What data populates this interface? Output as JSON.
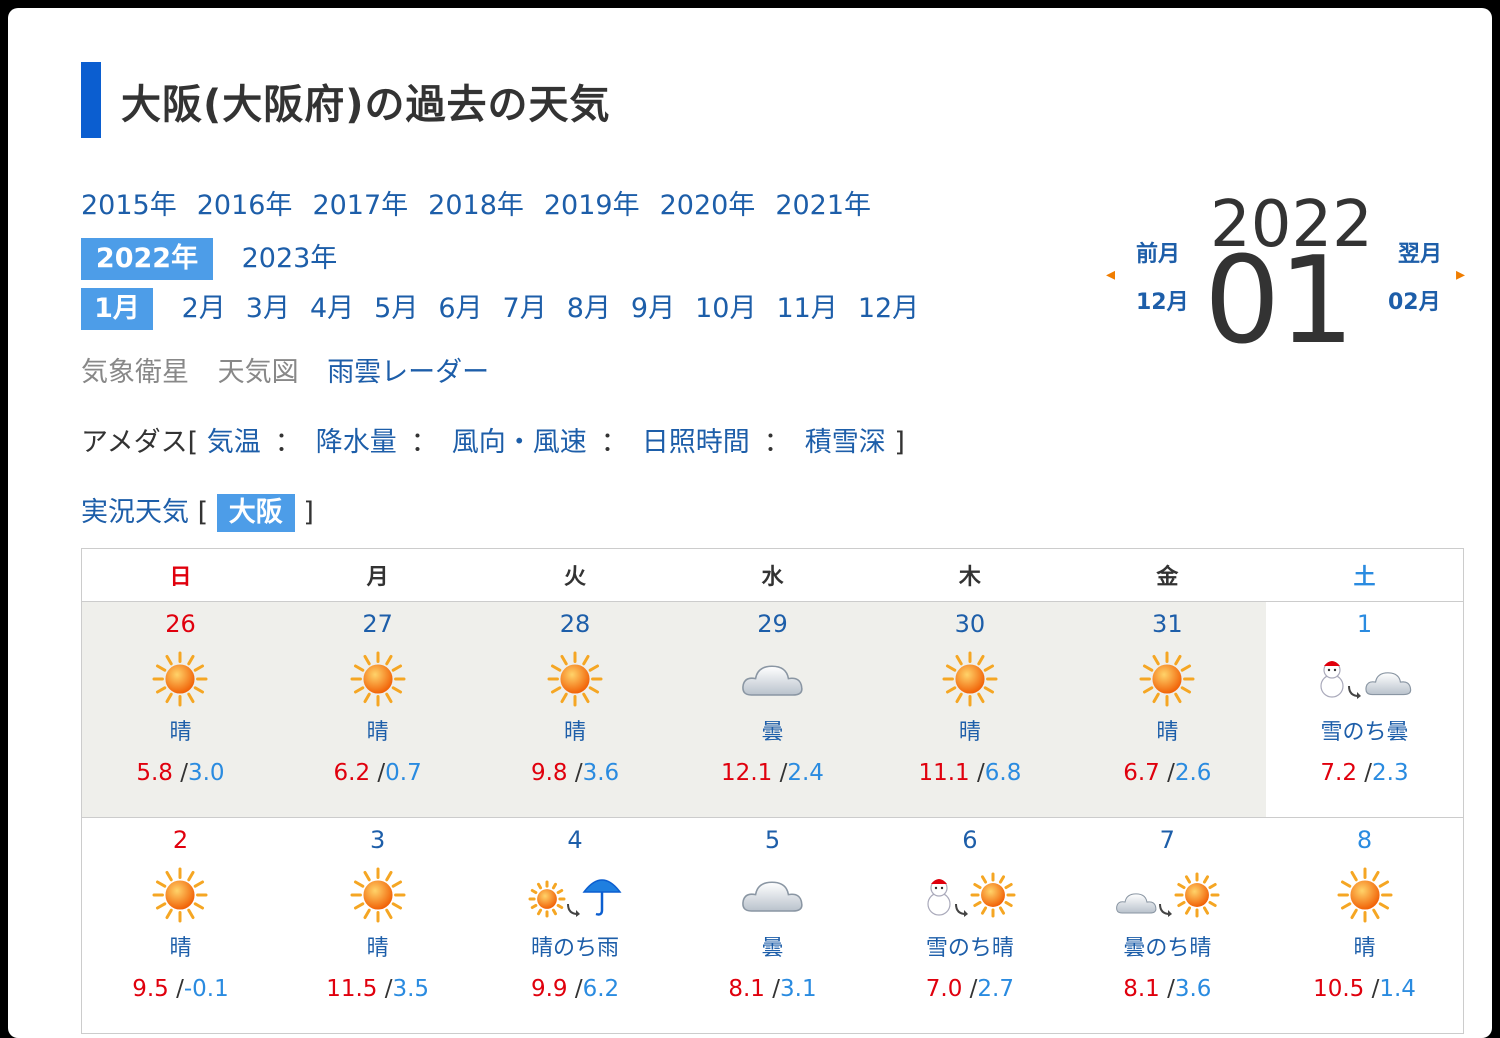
{
  "title": "大阪(大阪府)の過去の天気",
  "years": [
    "2015年",
    "2016年",
    "2017年",
    "2018年",
    "2019年",
    "2020年",
    "2021年"
  ],
  "years_row2_selected": "2022年",
  "years_row2_other": "2023年",
  "months_selected": "1月",
  "months": [
    "2月",
    "3月",
    "4月",
    "5月",
    "6月",
    "7月",
    "8月",
    "9月",
    "10月",
    "11月",
    "12月"
  ],
  "maps": {
    "satellite": "気象衛星",
    "weathermap": "天気図",
    "radar": "雨雲レーダー"
  },
  "amedas": {
    "prefix": "アメダス[",
    "items": [
      "気温",
      "降水量",
      "風向・風速",
      "日照時間",
      "積雪深"
    ],
    "sep": "：",
    "suffix": "]"
  },
  "jikkyo": {
    "label": "実況天気",
    "open": "[",
    "selected": "大阪",
    "close": "]"
  },
  "nav": {
    "year": "2022",
    "month": "01",
    "prev_label": "前月",
    "prev_month": "12月",
    "next_label": "翌月",
    "next_month": "02月",
    "arrow_color": "#f07d00"
  },
  "weekdays": [
    "日",
    "月",
    "火",
    "水",
    "木",
    "金",
    "土"
  ],
  "weeks": [
    [
      {
        "day": "26",
        "icon": "sun",
        "label": "晴",
        "hi": "5.8",
        "lo": "3.0",
        "prev": true
      },
      {
        "day": "27",
        "icon": "sun",
        "label": "晴",
        "hi": "6.2",
        "lo": "0.7",
        "prev": true
      },
      {
        "day": "28",
        "icon": "sun",
        "label": "晴",
        "hi": "9.8",
        "lo": "3.6",
        "prev": true
      },
      {
        "day": "29",
        "icon": "cloud",
        "label": "曇",
        "hi": "12.1",
        "lo": "2.4",
        "prev": true
      },
      {
        "day": "30",
        "icon": "sun",
        "label": "晴",
        "hi": "11.1",
        "lo": "6.8",
        "prev": true
      },
      {
        "day": "31",
        "icon": "sun",
        "label": "晴",
        "hi": "6.7",
        "lo": "2.6",
        "prev": true
      },
      {
        "day": "1",
        "icon": "snow-then-cloud",
        "label": "雪のち曇",
        "hi": "7.2",
        "lo": "2.3",
        "prev": false
      }
    ],
    [
      {
        "day": "2",
        "icon": "sun",
        "label": "晴",
        "hi": "9.5",
        "lo": "-0.1",
        "prev": false
      },
      {
        "day": "3",
        "icon": "sun",
        "label": "晴",
        "hi": "11.5",
        "lo": "3.5",
        "prev": false
      },
      {
        "day": "4",
        "icon": "sun-then-rain",
        "label": "晴のち雨",
        "hi": "9.9",
        "lo": "6.2",
        "prev": false
      },
      {
        "day": "5",
        "icon": "cloud",
        "label": "曇",
        "hi": "8.1",
        "lo": "3.1",
        "prev": false
      },
      {
        "day": "6",
        "icon": "snow-then-sun",
        "label": "雪のち晴",
        "hi": "7.0",
        "lo": "2.7",
        "prev": false
      },
      {
        "day": "7",
        "icon": "cloud-then-sun",
        "label": "曇のち晴",
        "hi": "8.1",
        "lo": "3.6",
        "prev": false
      },
      {
        "day": "8",
        "icon": "sun",
        "label": "晴",
        "hi": "10.5",
        "lo": "1.4",
        "prev": false
      }
    ]
  ],
  "colors": {
    "link": "#1d5ea9",
    "selected_bg": "#4d9de8",
    "title_bar": "#0b5ed0",
    "high": "#e0000d",
    "low": "#2a8be0"
  }
}
